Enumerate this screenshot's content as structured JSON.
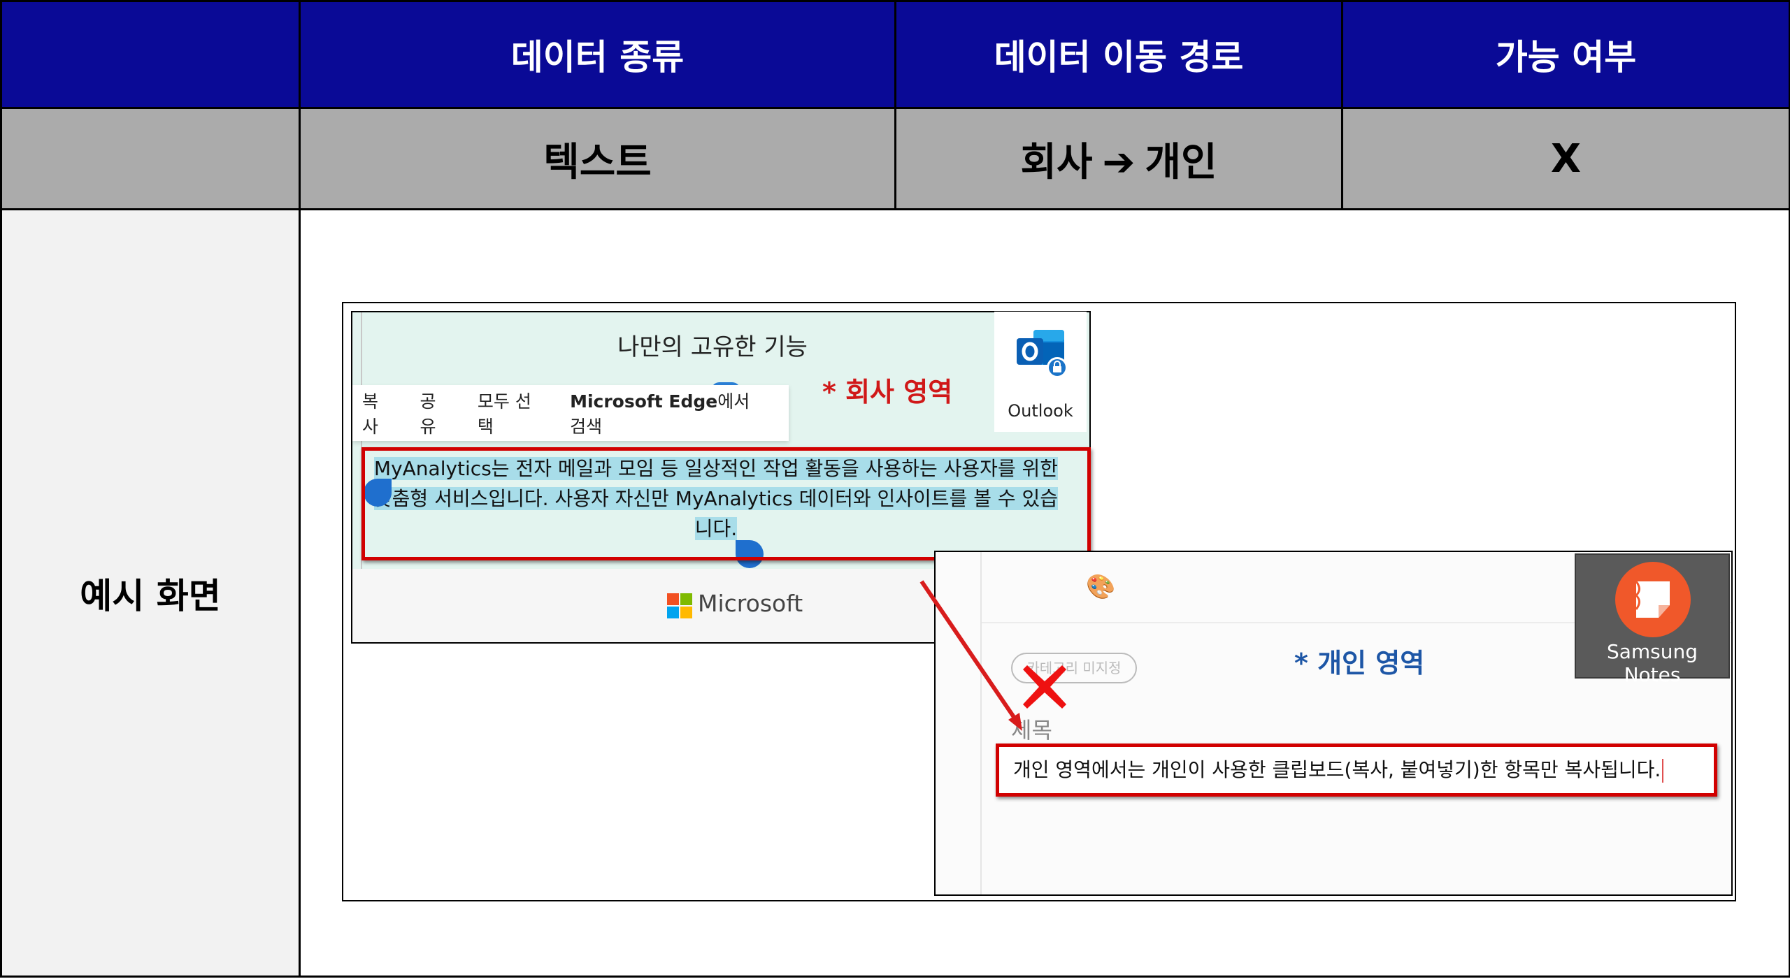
{
  "table": {
    "header": {
      "col0": "",
      "col1": "데이터 종류",
      "col2": "데이터 이동 경로",
      "col3": "가능 여부"
    },
    "row": {
      "col0": "",
      "data_type": "텍스트",
      "route_from": "회사",
      "route_arrow": "➔",
      "route_to": "개인",
      "allowed": "X"
    },
    "example_label": "예시 화면"
  },
  "example": {
    "company_app": {
      "title": "나만의 고유한 기능",
      "menu": [
        "복사",
        "공유",
        "모두 선택"
      ],
      "menu_search": {
        "bold": "Microsoft Edge",
        "rest": "에서 검색"
      },
      "selected_text": "MyAnalytics는 전자 메일과 모임 등 일상적인 작업 활동을 사용하는 사용자를 위한 맞춤형 서비스입니다. 사용자 자신만 MyAnalytics 데이터와 인사이트를 볼 수 있습니다.",
      "footer_brand": "Microsoft",
      "app_name": "Outlook",
      "zone_label": "* 회사 영역"
    },
    "personal_app": {
      "category_chip": "카테고리 미지정",
      "title_placeholder": "제목",
      "body_text": "개인 영역에서는 개인이 사용한 클립보드(복사, 붙여넣기)한 항목만 복사됩니다.",
      "app_name": "Samsung Notes",
      "zone_label": "* 개인 영역"
    },
    "colors": {
      "header_bg": "#0a0a96",
      "row_bg": "#ababab",
      "highlight": "#d10000",
      "corp_label": "#d01818",
      "personal_label": "#1d56a6"
    },
    "icons": [
      "outlook-icon",
      "microsoft-logo-icon",
      "palette-icon",
      "samsung-notes-icon",
      "blocked-x-icon",
      "arrow-icon"
    ]
  }
}
